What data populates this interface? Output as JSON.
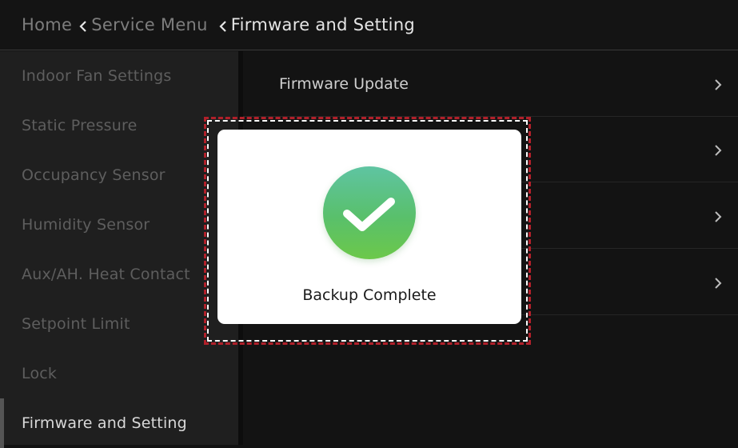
{
  "header": {
    "breadcrumb": [
      "Home",
      "Service Menu",
      "Firmware and Setting"
    ]
  },
  "sidebar": {
    "items": [
      {
        "label": "Indoor Fan Settings",
        "active": false
      },
      {
        "label": "Static Pressure",
        "active": false
      },
      {
        "label": "Occupancy Sensor",
        "active": false
      },
      {
        "label": "Humidity Sensor",
        "active": false
      },
      {
        "label": "Aux/AH. Heat Contact",
        "active": false
      },
      {
        "label": "Setpoint Limit",
        "active": false
      },
      {
        "label": "Lock",
        "active": false
      },
      {
        "label": "Firmware and Setting",
        "active": true
      }
    ]
  },
  "main": {
    "rows": [
      {
        "label": "Firmware Update",
        "icon": "chevron-right-icon"
      },
      {
        "label": "",
        "icon": "chevron-right-icon"
      },
      {
        "label": "",
        "icon": "chevron-right-icon"
      },
      {
        "label": "",
        "icon": "chevron-right-icon"
      }
    ]
  },
  "dialog": {
    "icon": "checkmark-circle-icon",
    "message": "Backup Complete",
    "accent_color": "#5ec26a"
  }
}
